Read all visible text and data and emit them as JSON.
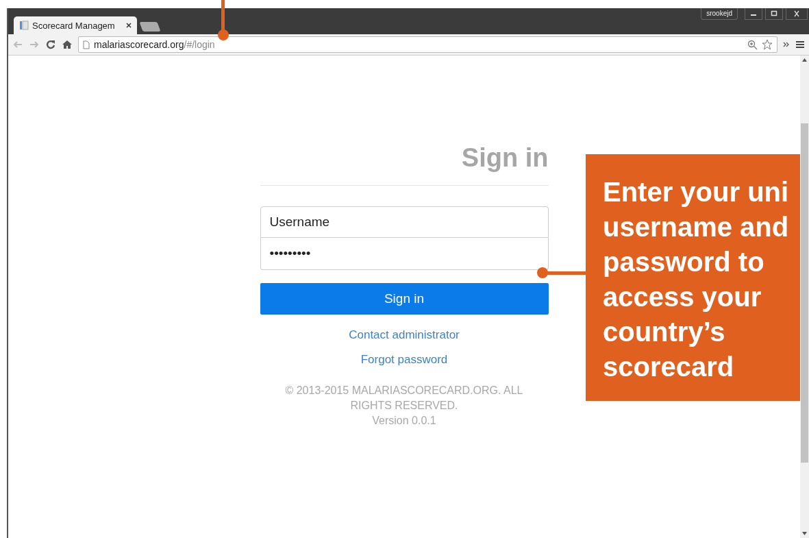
{
  "browser": {
    "tab": {
      "title": "Scorecard Managem",
      "selected": true
    },
    "profile": "srookejd",
    "address": {
      "host": "malariascorecard.org",
      "path": "/#/login"
    }
  },
  "login": {
    "heading": "Sign in",
    "username": {
      "placeholder": "Username"
    },
    "password": {
      "value": "•••••••••"
    },
    "submit": "Sign in",
    "links": [
      "Contact administrator",
      "Forgot password"
    ],
    "footer": [
      "© 2013-2015 MALARIASCORECARD.ORG. ALL RIGHTS RESERVED.",
      "Version 0.0.1"
    ]
  },
  "callout": {
    "text": "Enter your uni\nusername and\npassword to\naccess your\ncountry’s\nscorecard"
  }
}
